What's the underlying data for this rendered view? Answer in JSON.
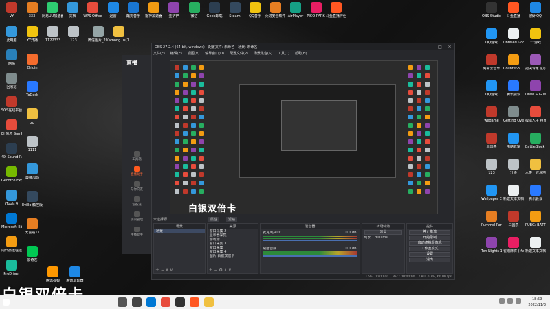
{
  "desktop_left": [
    {
      "label": "VY",
      "color": "#c0392b"
    },
    {
      "label": "333",
      "color": "#e67e22"
    },
    {
      "label": "网易UU加速器",
      "color": "#2ecc71"
    },
    {
      "label": "文档",
      "color": "#3498db"
    },
    {
      "label": "WPS Office",
      "color": "#e74c3c"
    },
    {
      "label": "迅雷",
      "color": "#1e88e5"
    },
    {
      "label": "酷狗音乐",
      "color": "#1976d2"
    },
    {
      "label": "雷神加速器",
      "color": "#f39c12"
    },
    {
      "label": "金铲铲",
      "color": "#8e44ad"
    },
    {
      "label": "微信",
      "color": "#27ae60"
    },
    {
      "label": "Geek卸载",
      "color": "#2c3e50"
    },
    {
      "label": "Steam",
      "color": "#34495e"
    },
    {
      "label": "QQ音乐",
      "color": "#f1c40f"
    },
    {
      "label": "火绒安全软件",
      "color": "#e67e22"
    },
    {
      "label": "AirPlayer",
      "color": "#16a085"
    },
    {
      "label": "PICO PARK",
      "color": "#e91e63"
    },
    {
      "label": "斗鱼直播伴侣",
      "color": "#ff5722"
    }
  ],
  "desktop_col": [
    {
      "label": "此电脑",
      "color": "#3498db"
    },
    {
      "label": "网络",
      "color": "#2980b9"
    },
    {
      "label": "回收站",
      "color": "#7f8c8d"
    },
    {
      "label": "SOS在线平台",
      "color": "#c0392b"
    },
    {
      "label": "EI 信息 SamProf新版",
      "color": "#e74c3c"
    },
    {
      "label": "4D Sound Recorder",
      "color": "#2c3e50"
    },
    {
      "label": "GeForce Experience",
      "color": "#76b900"
    },
    {
      "label": "iTools 4",
      "color": "#3498db"
    },
    {
      "label": "Microsoft Edge",
      "color": "#0078d4"
    },
    {
      "label": "向日葵远程控制",
      "color": "#f39c12"
    },
    {
      "label": "ProDriver",
      "color": "#1abc9c"
    }
  ],
  "desktop_col2": [
    {
      "label": "YY开播",
      "color": "#f1c40f"
    },
    {
      "label": "Origin",
      "color": "#f56c2d"
    },
    {
      "label": "ToDesk",
      "color": "#2979ff"
    },
    {
      "label": "zq",
      "color": "#f0c040"
    },
    {
      "label": "1111",
      "color": "#bdc3c7"
    },
    {
      "label": "最嗨加码",
      "color": "#3498db"
    },
    {
      "label": "Evillo 触控版",
      "color": "#34495e"
    },
    {
      "label": "大富翁11",
      "color": "#e67e22"
    },
    {
      "label": "爱奇艺",
      "color": "#00c853"
    }
  ],
  "desktop_misc": [
    {
      "label": "1122333",
      "color": "#bdc3c7"
    },
    {
      "label": "123",
      "color": "#bdc3c7"
    },
    {
      "label": "微信图片_2021120...",
      "color": "#95a5a6"
    },
    {
      "label": "among us(1)",
      "color": "#f0c040"
    },
    {
      "label": "腾讯视频",
      "color": "#ff9800"
    },
    {
      "label": "腾讯启动器",
      "color": "#1e88e5"
    }
  ],
  "desktop_right": [
    {
      "label": "OBS Studio",
      "color": "#333"
    },
    {
      "label": "斗鱼直播",
      "color": "#ff5722"
    },
    {
      "label": "腾讯QQ",
      "color": "#1e88e5"
    },
    {
      "label": "QQ游戏",
      "color": "#2196f3"
    },
    {
      "label": "Untitled Goos...",
      "color": "#ecf0f1"
    },
    {
      "label": "YY游戏",
      "color": "#f1c40f"
    },
    {
      "label": "网易云音乐",
      "color": "#c0392b"
    },
    {
      "label": "Counter-S... Global Off...",
      "color": "#f39c12"
    },
    {
      "label": "指尖专家写方式版",
      "color": "#9b59b6"
    },
    {
      "label": "QQ游戏",
      "color": "#2196f3"
    },
    {
      "label": "腾讯会议",
      "color": "#2979ff"
    },
    {
      "label": "Draw & Guess",
      "color": "#8e44ad"
    },
    {
      "label": "wegame",
      "color": "#c0392b"
    },
    {
      "label": "Getting Over It wi...",
      "color": "#7f8c8d"
    },
    {
      "label": "模拟人生 柯南",
      "color": "#e74c3c"
    },
    {
      "label": "三国杀",
      "color": "#c0392b"
    },
    {
      "label": "电脑管家",
      "color": "#2196f3"
    },
    {
      "label": "BattleBlock Theater",
      "color": "#27ae60"
    },
    {
      "label": "123",
      "color": "#bdc3c7"
    },
    {
      "label": "升级",
      "color": "#bdc3c7"
    },
    {
      "label": "人类一败涂地 Human: Fal...",
      "color": "#f0c040"
    },
    {
      "label": "Wallpaper Engine: ...",
      "color": "#2196f3"
    },
    {
      "label": "新建文本文档",
      "color": "#ecf0f1"
    },
    {
      "label": "腾讯会议",
      "color": "#2979ff"
    },
    {
      "label": "Pummel Party",
      "color": "#e67e22"
    },
    {
      "label": "三国杀",
      "color": "#c0392b"
    },
    {
      "label": "PUBG: BATTLEG...",
      "color": "#f39c12"
    },
    {
      "label": "Ten Nights 10(Kitche...",
      "color": "#8e44ad"
    },
    {
      "label": "雀魂麻将 (Mahjong...",
      "color": "#e91e63"
    },
    {
      "label": "新建文本文档 (2)",
      "color": "#ecf0f1"
    }
  ],
  "obs": {
    "title": "OBS 27.2.4 (64-bit, windows) - 配置文件: 未命名 - 场景: 未命名",
    "menu": [
      "文件(F)",
      "编辑(E)",
      "视图(V)",
      "停靠窗口(D)",
      "配置文件(P)",
      "场景集合(S)",
      "工具(T)",
      "帮助(H)"
    ],
    "overlay_text": "白银双倍卡",
    "scene_bar_label": "未选择源",
    "scene_bar_props": "属性",
    "scene_bar_filters": "滤镜",
    "docks": {
      "scenes": {
        "title": "场景",
        "items": [
          "场景"
        ]
      },
      "sources": {
        "title": "来源",
        "items": [
          "窗口采集 2",
          "显示器采集",
          "游戏源",
          "窗口采集 3",
          "窗口采集",
          "窗口采集 4",
          "图片 白银双倍卡"
        ]
      },
      "mixer": {
        "title": "混音器",
        "tracks": [
          {
            "name": "麦克风/Aux",
            "level": "0.0 dB"
          },
          {
            "name": "桌面音频",
            "level": "0.0 dB"
          }
        ]
      },
      "transitions": {
        "title": "转场特效",
        "type": "淡出",
        "duration_label": "时长",
        "duration": "300 ms"
      },
      "controls": {
        "title": "控件",
        "buttons": [
          "停止推流",
          "开始录制",
          "启动虚拟摄像机",
          "工作室模式",
          "设置",
          "退出"
        ]
      }
    },
    "status": {
      "live": "LIVE: 00:00:00",
      "rec": "REC: 00:00:00",
      "cpu": "CPU: 0.7%, 60.00 fps"
    }
  },
  "side_app": {
    "brand": "直播",
    "items": [
      {
        "label": "工具箱",
        "active": false
      },
      {
        "label": "直播助手",
        "active": true
      },
      {
        "label": "与你交友",
        "active": false
      },
      {
        "label": "设备道",
        "active": false
      },
      {
        "label": "房间管理",
        "active": false
      },
      {
        "label": "主播助手",
        "active": false
      }
    ]
  },
  "big_caption": "白银双倍卡",
  "taskbar": {
    "icons": [
      {
        "name": "search-icon",
        "color": "#555"
      },
      {
        "name": "task-view-icon",
        "color": "#444"
      },
      {
        "name": "edge-icon",
        "color": "#0078d4"
      },
      {
        "name": "chrome-icon",
        "color": "#e74c3c"
      },
      {
        "name": "obs-icon",
        "color": "#333"
      },
      {
        "name": "douyu-icon",
        "color": "#ff5722"
      },
      {
        "name": "folder-icon",
        "color": "#f0c040"
      }
    ],
    "time": "18:59",
    "date": "2022/11/3"
  }
}
